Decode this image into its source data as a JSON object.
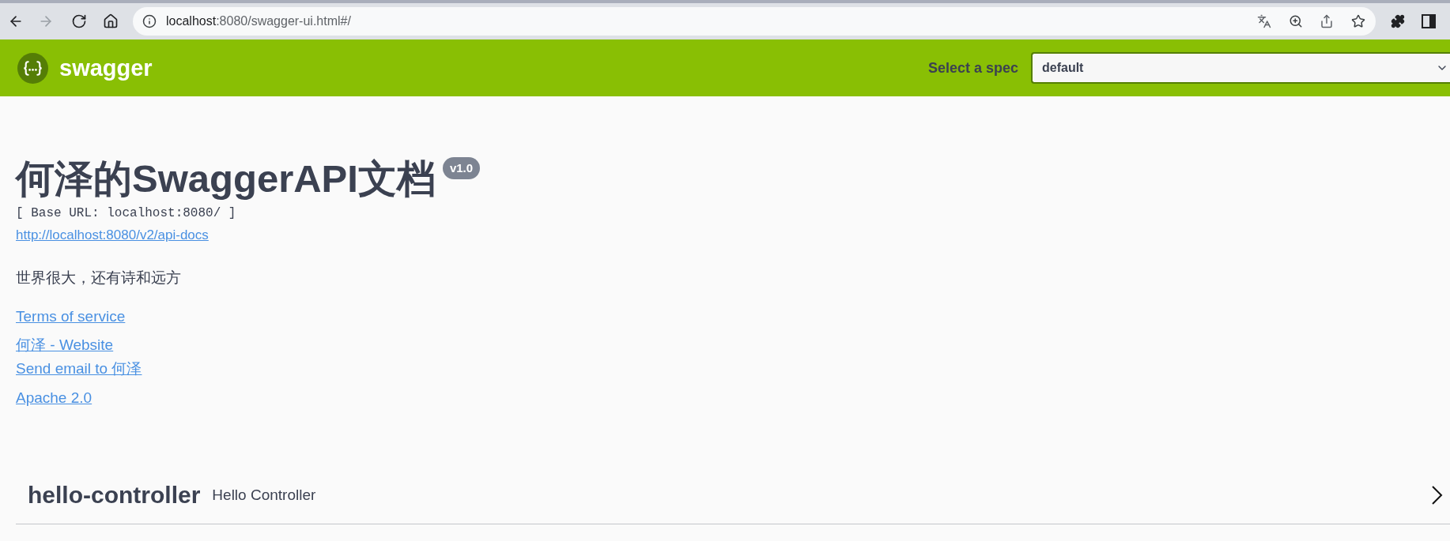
{
  "browser": {
    "back_disabled": false,
    "forward_disabled": true,
    "address": {
      "host": "localhost",
      "path": ":8080/swagger-ui.html#/"
    }
  },
  "top_bar": {
    "logo_text": "swagger",
    "spec_label": "Select a spec",
    "spec_value": "default"
  },
  "info": {
    "title": "何泽的SwaggerAPI文档",
    "version": "v1.0",
    "base_url": "[ Base URL: localhost:8080/ ]",
    "docs_link": "http://localhost:8080/v2/api-docs",
    "description": "世界很大，还有诗和远方",
    "terms_link": "Terms of service",
    "contact_links": [
      "何泽 - Website",
      "Send email to 何泽"
    ],
    "license_link": "Apache 2.0"
  },
  "tags": [
    {
      "name": "hello-controller",
      "description": "Hello Controller",
      "expanded": false
    }
  ]
}
